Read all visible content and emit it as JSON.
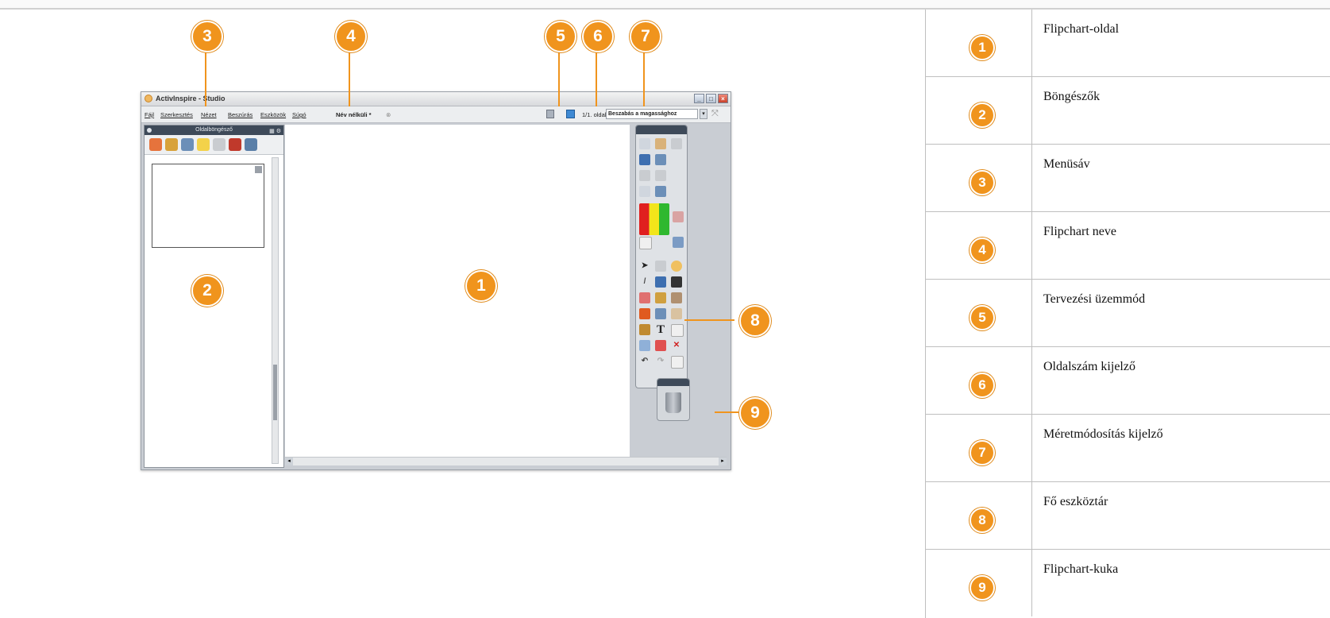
{
  "screenshot": {
    "title": "ActivInspire - Studio",
    "menu": [
      "Fájl",
      "Szerkesztés",
      "Nézet",
      "Beszúrás",
      "Eszközök",
      "Súgó"
    ],
    "flipchart_name": "Név nélküli *",
    "page_indicator": "1/1. oldal",
    "zoom_label": "Beszabás a magassághoz",
    "browser_title": "Oldalböngésző"
  },
  "callouts": [
    "1",
    "2",
    "3",
    "4",
    "5",
    "6",
    "7",
    "8",
    "9"
  ],
  "legend": [
    {
      "number": "1",
      "label": "Flipchart-oldal"
    },
    {
      "number": "2",
      "label": "Böngészők"
    },
    {
      "number": "3",
      "label": "Menüsáv"
    },
    {
      "number": "4",
      "label": "Flipchart neve"
    },
    {
      "number": "5",
      "label": "Tervezési üzemmód"
    },
    {
      "number": "6",
      "label": "Oldalszám kijelző"
    },
    {
      "number": "7",
      "label": "Méretmódosítás kijelző"
    },
    {
      "number": "8",
      "label": "Fő eszköztár"
    },
    {
      "number": "9",
      "label": "Flipchart-kuka"
    }
  ],
  "colors": {
    "callout": "#f0941d",
    "toolbar_dark": "#3e4a59"
  }
}
